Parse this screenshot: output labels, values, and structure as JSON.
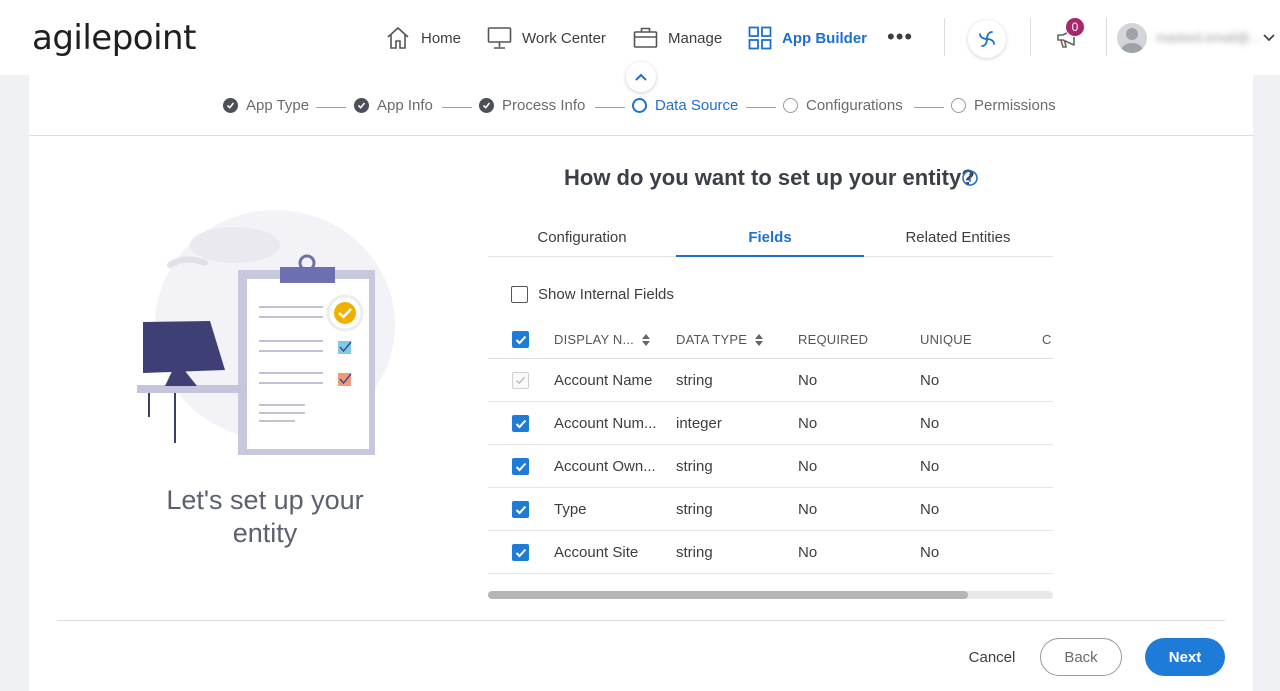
{
  "brand": {
    "logo_text": "agilepoint",
    "accent": "#1f7bd8"
  },
  "nav": {
    "items": [
      {
        "label": "Home",
        "icon": "home-icon"
      },
      {
        "label": "Work Center",
        "icon": "monitor-icon"
      },
      {
        "label": "Manage",
        "icon": "briefcase-icon"
      },
      {
        "label": "App Builder",
        "icon": "grid-icon",
        "active": true
      }
    ],
    "more_label": "•••",
    "notifications_count": "0",
    "user_name": "masked.email@..."
  },
  "stepper": {
    "steps": [
      {
        "label": "App Type",
        "state": "done"
      },
      {
        "label": "App Info",
        "state": "done"
      },
      {
        "label": "Process Info",
        "state": "done"
      },
      {
        "label": "Data Source",
        "state": "current"
      },
      {
        "label": "Configurations",
        "state": "todo"
      },
      {
        "label": "Permissions",
        "state": "todo"
      }
    ]
  },
  "left": {
    "title_line1": "Let's set up your",
    "title_line2": "entity"
  },
  "main": {
    "heading": "How do you want to set up your entity?",
    "tabs": [
      "Configuration",
      "Fields",
      "Related Entities"
    ],
    "active_tab": "Fields",
    "show_internal_label": "Show Internal Fields",
    "columns": [
      "DISPLAY N...",
      "DATA TYPE",
      "REQUIRED",
      "UNIQUE",
      "C"
    ],
    "rows": [
      {
        "name": "Account Name",
        "type": "string",
        "required": "No",
        "unique": "No",
        "checked": "disabled"
      },
      {
        "name": "Account Num...",
        "type": "integer",
        "required": "No",
        "unique": "No",
        "checked": "true"
      },
      {
        "name": "Account Own...",
        "type": "string",
        "required": "No",
        "unique": "No",
        "checked": "true"
      },
      {
        "name": "Type",
        "type": "string",
        "required": "No",
        "unique": "No",
        "checked": "true"
      },
      {
        "name": "Account Site",
        "type": "string",
        "required": "No",
        "unique": "No",
        "checked": "true"
      }
    ],
    "scroll_fraction": 0.85
  },
  "footer": {
    "cancel": "Cancel",
    "back": "Back",
    "next": "Next"
  }
}
